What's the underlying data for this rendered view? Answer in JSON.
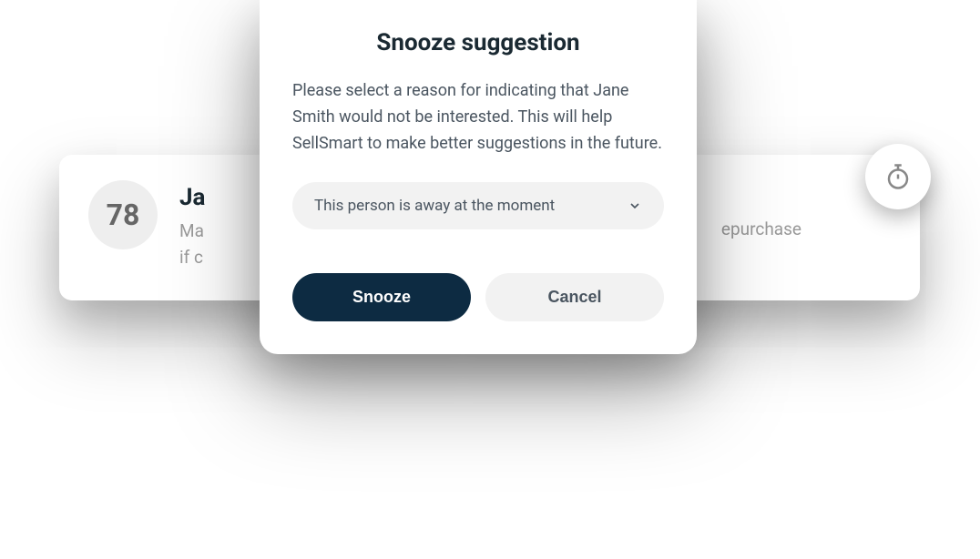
{
  "card": {
    "score": "78",
    "name": "Ja",
    "desc_line1": "Ma",
    "desc_line2": "if c",
    "desc_right": "epurchase"
  },
  "modal": {
    "title": "Snooze suggestion",
    "body": "Please select a reason for indicating that Jane Smith would not be interested. This will help SellSmart to make better suggestions in the future.",
    "select_value": "This person is away at the moment",
    "primary_label": "Snooze",
    "secondary_label": "Cancel"
  }
}
